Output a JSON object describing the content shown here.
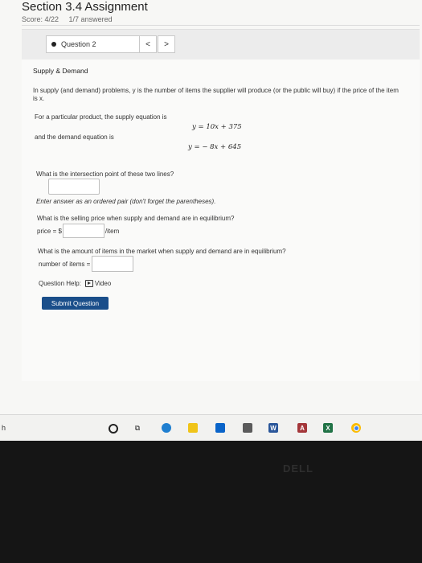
{
  "header": {
    "title": "Section 3.4 Assignment",
    "score": "Score: 4/22",
    "answered": "1/7 answered"
  },
  "question_nav": {
    "selected": "Question 2",
    "prev": "<",
    "next": ">"
  },
  "problem": {
    "title": "Supply & Demand",
    "intro": "In supply (and demand) problems, y is the number of items the supplier will produce (or the public will buy) if the price of the item is x.",
    "supply_label": "For a particular product, the supply equation is",
    "supply_equation": "y = 10x + 375",
    "demand_label": "and the demand equation is",
    "demand_equation": "y = − 8x + 645",
    "q1": "What is the intersection point of these two lines?",
    "q1_hint": "Enter answer as an ordered pair (don't forget the parentheses).",
    "q2": "What is the selling price when supply and demand are in equilibrium?",
    "price_prefix": "price = $",
    "price_suffix": "/item",
    "q3": "What is the amount of items in the market when supply and demand are in equilibrium?",
    "number_prefix": "number of items ="
  },
  "help": {
    "label": "Question Help:",
    "video": "Video"
  },
  "submit_label": "Submit Question",
  "taskbar": {
    "left_text": "h",
    "word": "W",
    "access": "A",
    "excel": "X",
    "taskview": "⧉"
  },
  "brand": "DELL"
}
